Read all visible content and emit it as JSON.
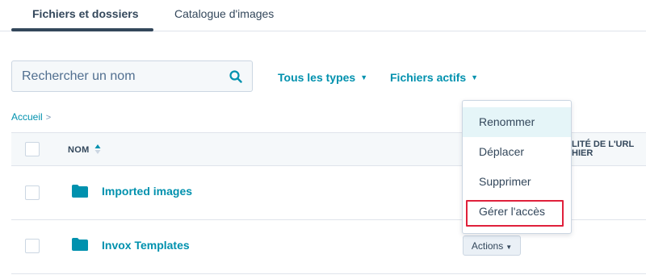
{
  "tabs": {
    "files_folders": "Fichiers et dossiers",
    "image_catalog": "Catalogue d'images"
  },
  "search": {
    "placeholder": "Rechercher un nom",
    "icon": "search-icon"
  },
  "filters": {
    "types": "Tous les types",
    "active_files": "Fichiers actifs"
  },
  "breadcrumb": {
    "home": "Accueil",
    "separator": ">"
  },
  "table": {
    "header_name": "NOM",
    "header_url_line1": "LITÉ DE L'URL",
    "header_url_line2": "HIER",
    "rows": [
      {
        "name": "Imported images",
        "icon": "folder-icon"
      },
      {
        "name": "Invox Templates",
        "icon": "folder-icon",
        "actions_label": "Actions"
      }
    ]
  },
  "menu": {
    "items": [
      "Renommer",
      "Déplacer",
      "Supprimer",
      "Gérer l'accès"
    ],
    "hovered": "Renommer",
    "highlighted": "Gérer l'accès"
  },
  "colors": {
    "link": "#0091ae",
    "text": "#33475b",
    "highlight": "#e0203b",
    "hover_bg": "#e5f5f8"
  }
}
